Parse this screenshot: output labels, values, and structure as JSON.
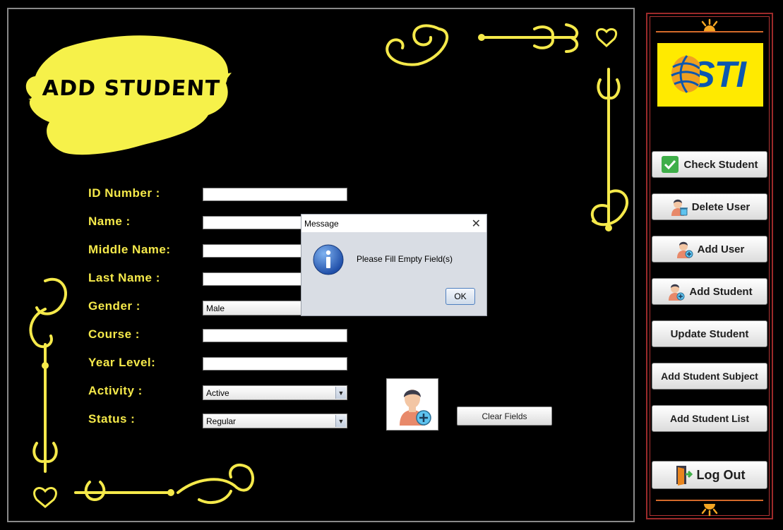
{
  "header": {
    "title": "ADD STUDENT"
  },
  "form": {
    "fields": [
      {
        "label": "ID Number :",
        "value": ""
      },
      {
        "label": "Name :",
        "value": ""
      },
      {
        "label": "Middle Name:",
        "value": ""
      },
      {
        "label": "Last Name :",
        "value": ""
      },
      {
        "label": "Gender :",
        "value": "Male"
      },
      {
        "label": "Course :",
        "value": ""
      },
      {
        "label": "Year Level:",
        "value": ""
      },
      {
        "label": "Activity :",
        "value": "Active"
      },
      {
        "label": "Status :",
        "value": "Regular"
      }
    ],
    "clear_label": "Clear Fields"
  },
  "sidebar": {
    "logo_text": "STI",
    "buttons": [
      {
        "label": "Check Student",
        "icon": "checkmark-icon"
      },
      {
        "label": "Delete User",
        "icon": "user-delete-icon"
      },
      {
        "label": "Add User",
        "icon": "user-add-icon"
      },
      {
        "label": "Add Student",
        "icon": "student-add-icon"
      },
      {
        "label": "Update Student",
        "icon": ""
      },
      {
        "label": "Add Student Subject",
        "icon": ""
      },
      {
        "label": "Add Student List",
        "icon": ""
      },
      {
        "label": "Log Out",
        "icon": "exit-door-icon"
      }
    ]
  },
  "dialog": {
    "title": "Message",
    "message": "Please Fill Empty Field(s)",
    "ok_label": "OK",
    "icon": "info-icon"
  },
  "colors": {
    "accent_yellow": "#f5e94a",
    "sidebar_border": "#9c2a2a",
    "logo_bg": "#ffea00",
    "logo_text": "#0b57b0"
  }
}
